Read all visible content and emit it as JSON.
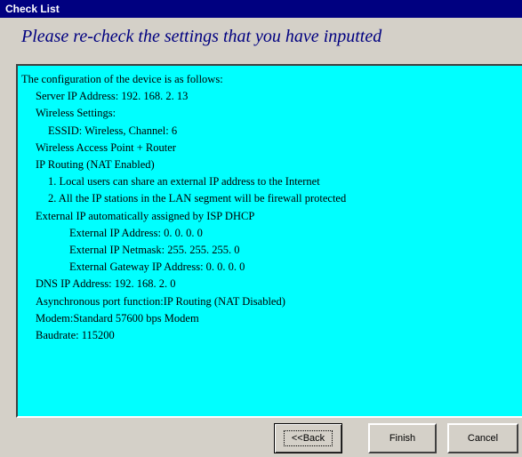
{
  "window": {
    "title": "Check List"
  },
  "header": {
    "subtitle": "Please re-check the settings that you have inputted"
  },
  "summary": {
    "lines": [
      "The configuration of the device is as follows:",
      "Server IP Address: 192. 168. 2. 13",
      "Wireless Settings:",
      "ESSID: Wireless,     Channel: 6",
      "Wireless Access Point + Router",
      "IP Routing (NAT Enabled)",
      "1. Local users can share an external IP address to the Internet",
      "2. All the IP stations in the LAN segment will be firewall protected",
      "External IP automatically assigned by ISP DHCP",
      "External IP Address: 0. 0. 0. 0",
      "External IP Netmask: 255. 255. 255. 0",
      "External Gateway IP Address: 0. 0. 0. 0",
      "DNS IP Address: 192. 168. 2. 0",
      "Asynchronous port function:IP Routing (NAT Disabled)",
      "Modem:Standard 57600 bps Modem",
      "Baudrate: 115200"
    ]
  },
  "buttons": {
    "back": "<<Back",
    "finish": "Finish",
    "cancel": "Cancel"
  },
  "colors": {
    "titlebar": "#000080",
    "panel": "#00ffff",
    "subtitle": "#000080",
    "face": "#d4d0c8"
  }
}
